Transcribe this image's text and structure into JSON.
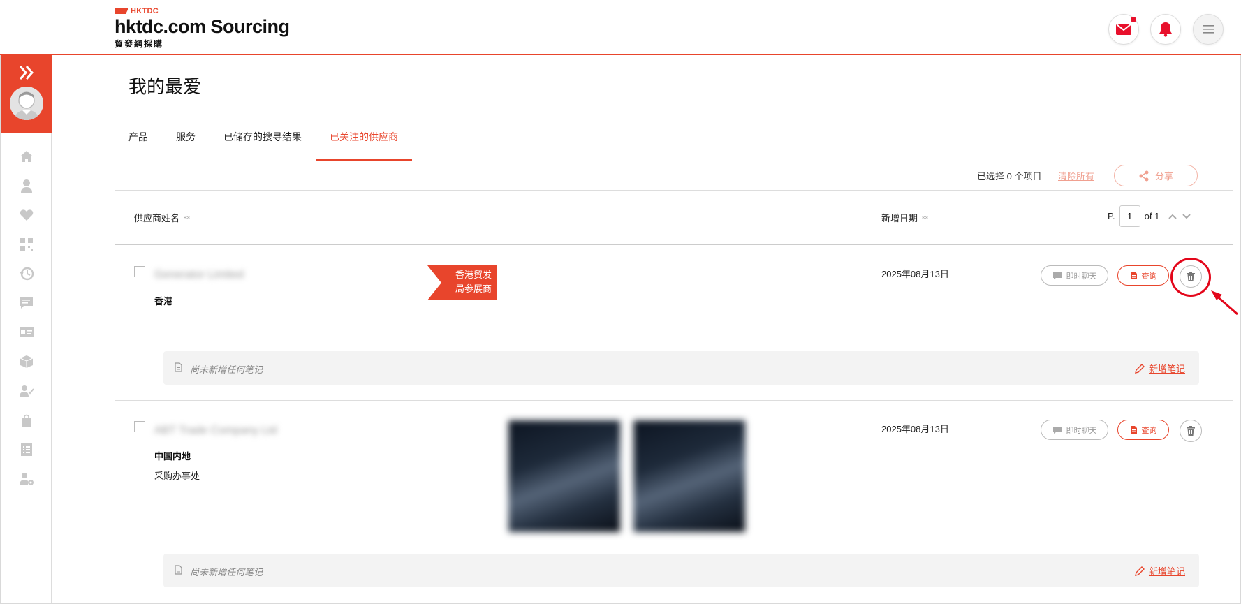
{
  "brand": {
    "top": "HKTDC",
    "name": "hktdc.com Sourcing",
    "sub": "貿發網採購"
  },
  "colors": {
    "accent": "#e8452c",
    "alert": "#e3061a"
  },
  "header": {
    "icons": [
      "mail-icon",
      "bell-icon",
      "menu-icon"
    ]
  },
  "sidebar": {
    "icons": [
      "home-icon",
      "user-icon",
      "heart-icon",
      "qr-icon",
      "history-icon",
      "message-icon",
      "card-icon",
      "box-icon",
      "user-check-icon",
      "bag-icon",
      "list-icon",
      "settings-user-icon"
    ]
  },
  "page": {
    "title": "我的最爱"
  },
  "tabs": [
    {
      "label": "产品"
    },
    {
      "label": "服务"
    },
    {
      "label": "已储存的搜寻结果"
    },
    {
      "label": "已关注的供应商"
    }
  ],
  "toolbar": {
    "selected_text": "已选择 0 个项目",
    "clear_all": "清除所有",
    "share": "分享"
  },
  "table": {
    "col_name": "供应商姓名",
    "col_date": "新增日期",
    "pager_prefix": "P.",
    "page_value": "1",
    "pager_of": "of 1"
  },
  "rows": [
    {
      "name": "Generator Limited",
      "region": "香港",
      "type": "",
      "badge_line1": "香港贸发",
      "badge_line2": "局参展商",
      "date": "2025年08月13日",
      "chat": "即时聊天",
      "inquiry": "查询",
      "note": "尚未新增任何笔记",
      "add_note": "新增笔记"
    },
    {
      "name": "ABT Trade Company Ltd",
      "region": "中国内地",
      "type": "采购办事处",
      "date": "2025年08月13日",
      "chat": "即时聊天",
      "inquiry": "查询",
      "note": "尚未新增任何笔记",
      "add_note": "新增笔记"
    }
  ]
}
